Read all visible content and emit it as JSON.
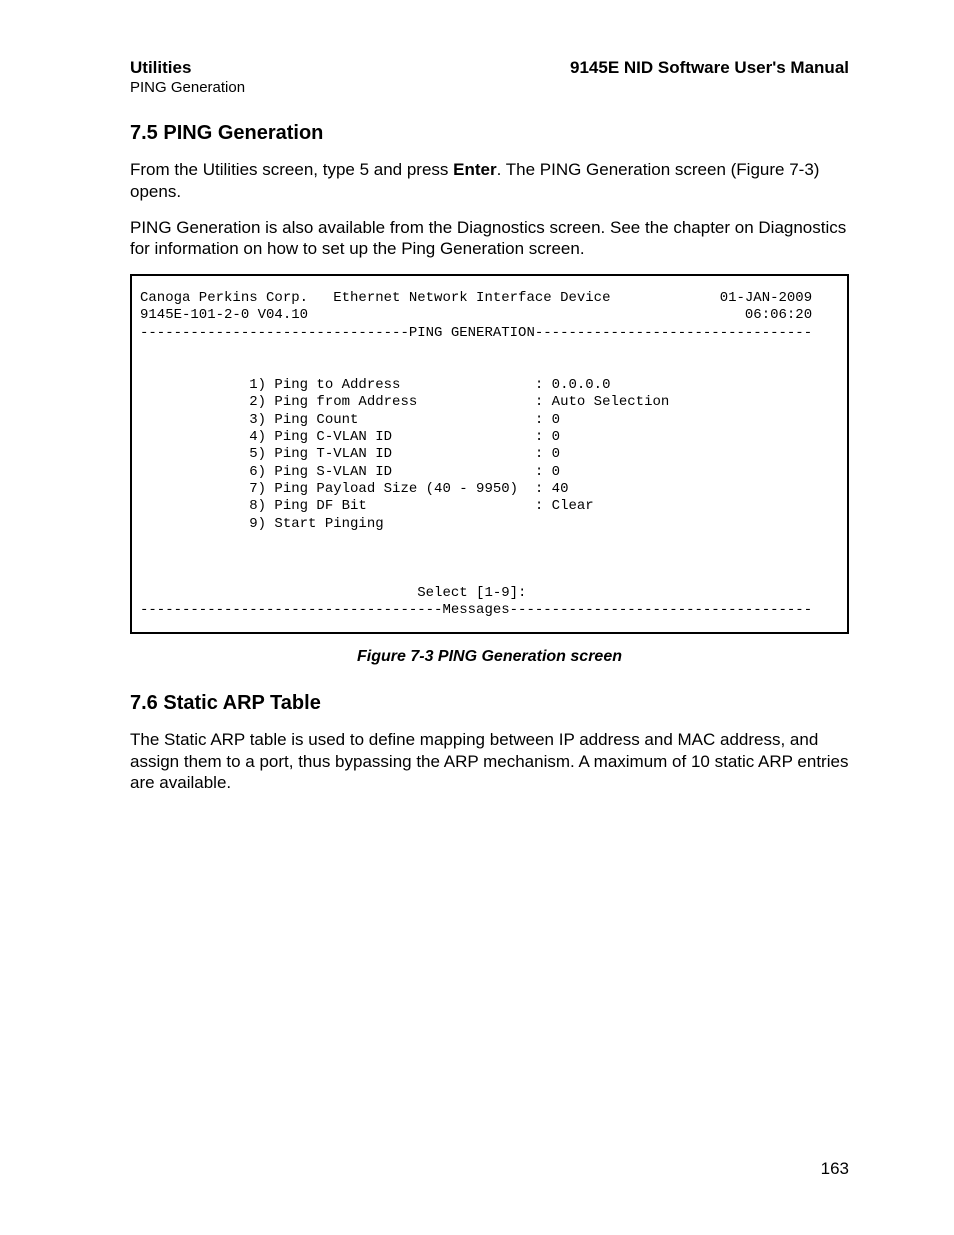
{
  "header": {
    "left_bold": "Utilities",
    "left_sub": "PING Generation",
    "right_bold": "9145E NID Software User's Manual"
  },
  "section1": {
    "heading": "7.5  PING Generation",
    "para1_a": "From the Utilities screen, type 5 and press ",
    "para1_enter": "Enter",
    "para1_b": ". The PING Generation screen (Figure 7-3) opens.",
    "para2": "PING Generation is also available from the Diagnostics screen. See the chapter on Diagnostics for information on how to set up the Ping Generation screen."
  },
  "terminal": {
    "company": "Canoga Perkins Corp.",
    "device": "Ethernet Network Interface Device",
    "date": "01-JAN-2009",
    "model": "9145E-101-2-0 V04.10",
    "time": "06:06:20",
    "banner": "PING GENERATION",
    "fields": [
      {
        "num": "1",
        "label": "Ping to Address",
        "value": "0.0.0.0"
      },
      {
        "num": "2",
        "label": "Ping from Address",
        "value": "Auto Selection"
      },
      {
        "num": "3",
        "label": "Ping Count",
        "value": "0"
      },
      {
        "num": "4",
        "label": "Ping C-VLAN ID",
        "value": "0"
      },
      {
        "num": "5",
        "label": "Ping T-VLAN ID",
        "value": "0"
      },
      {
        "num": "6",
        "label": "Ping S-VLAN ID",
        "value": "0"
      },
      {
        "num": "7",
        "label": "Ping Payload Size (40 - 9950)",
        "value": "40"
      },
      {
        "num": "8",
        "label": "Ping DF Bit",
        "value": "Clear"
      },
      {
        "num": "9",
        "label": "Start Pinging",
        "value": ""
      }
    ],
    "prompt": "Select [1-9]:",
    "messages": "Messages"
  },
  "figure_caption": "Figure 7-3  PING Generation screen",
  "section2": {
    "heading": "7.6  Static ARP Table",
    "para1": "The Static ARP table is used to define mapping between IP address and MAC address, and assign them to a port, thus bypassing the ARP mechanism. A maximum of 10 static ARP entries are available."
  },
  "page_number": "163"
}
